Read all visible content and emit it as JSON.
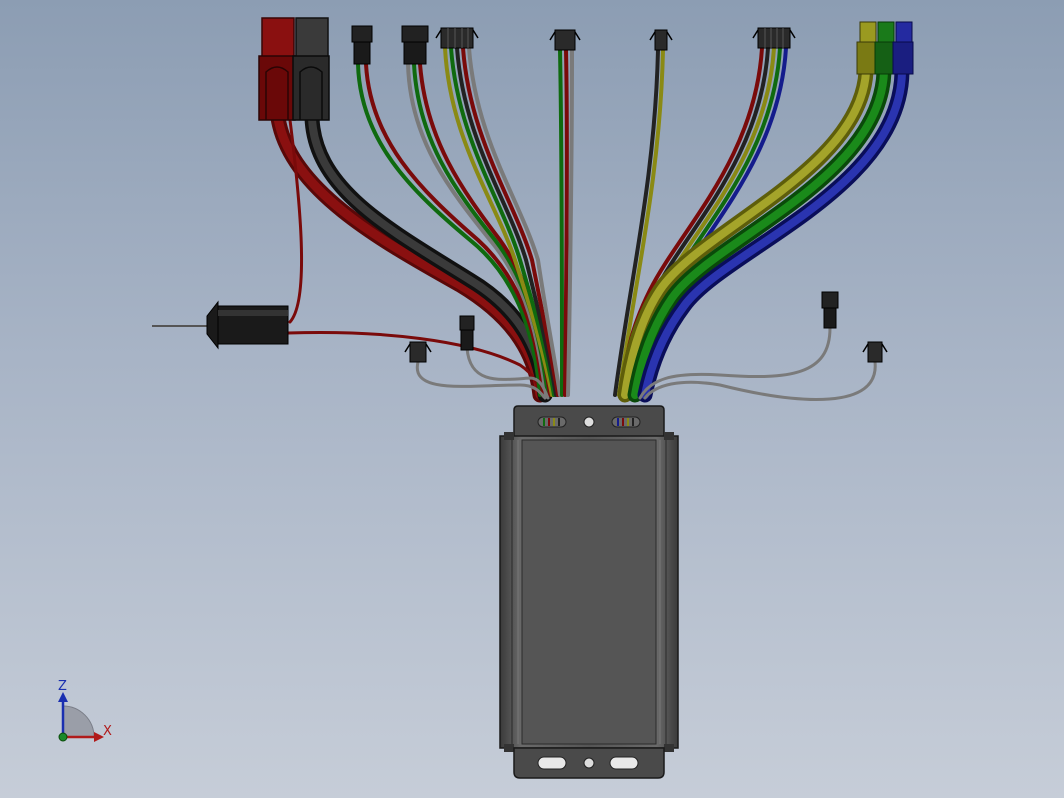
{
  "view": {
    "background_top": "#8c9db3",
    "background_bottom": "#c6cdd8"
  },
  "axes_triad": {
    "z_label": "Z",
    "x_label": "X",
    "z_color": "#1a2fb0",
    "x_color": "#b01a1a",
    "y_color": "#1a8a2a"
  },
  "model": {
    "controller_color": "#505050",
    "wire_colors": {
      "red": "#7a0a0a",
      "black": "#222222",
      "green": "#0f6a0f",
      "yellow": "#8a8a14",
      "blue": "#141c8c",
      "gray": "#7a7a7a"
    },
    "connectors": [
      {
        "name": "power-red",
        "color": "#7a0a0a"
      },
      {
        "name": "power-black",
        "color": "#2a2a2a"
      },
      {
        "name": "phase-yellow",
        "color": "#9a9a20"
      },
      {
        "name": "phase-green",
        "color": "#156a15"
      },
      {
        "name": "phase-blue",
        "color": "#1a1e8a"
      }
    ]
  }
}
